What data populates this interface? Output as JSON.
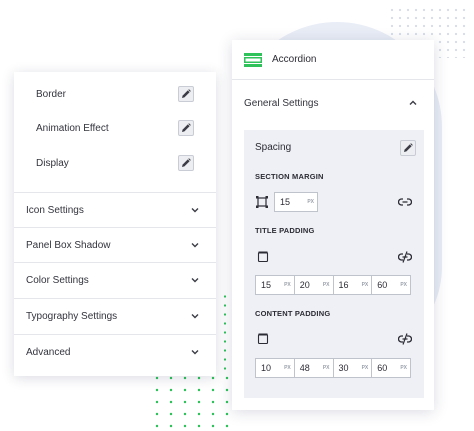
{
  "left_panel": {
    "items": [
      {
        "label": "Border"
      },
      {
        "label": "Animation Effect"
      },
      {
        "label": "Display"
      }
    ],
    "sections": [
      {
        "label": "Icon Settings"
      },
      {
        "label": "Panel Box Shadow"
      },
      {
        "label": "Color Settings"
      },
      {
        "label": "Typography Settings"
      },
      {
        "label": "Advanced"
      }
    ]
  },
  "right_panel": {
    "widget_title": "Accordion",
    "section_title": "General Settings",
    "spacing": {
      "title": "Spacing",
      "section_margin": {
        "label": "SECTION MARGIN",
        "value": "15",
        "unit": "PX"
      },
      "title_padding": {
        "label": "TITLE PADDING",
        "values": [
          "15",
          "20",
          "16",
          "60"
        ],
        "unit": "PX"
      },
      "content_padding": {
        "label": "CONTENT PADDING",
        "values": [
          "10",
          "48",
          "30",
          "60"
        ],
        "unit": "PX"
      }
    }
  },
  "colors": {
    "accent_green": "#2fc25b",
    "panel_bg": "#eef0f5",
    "border": "#e4e6ec"
  }
}
